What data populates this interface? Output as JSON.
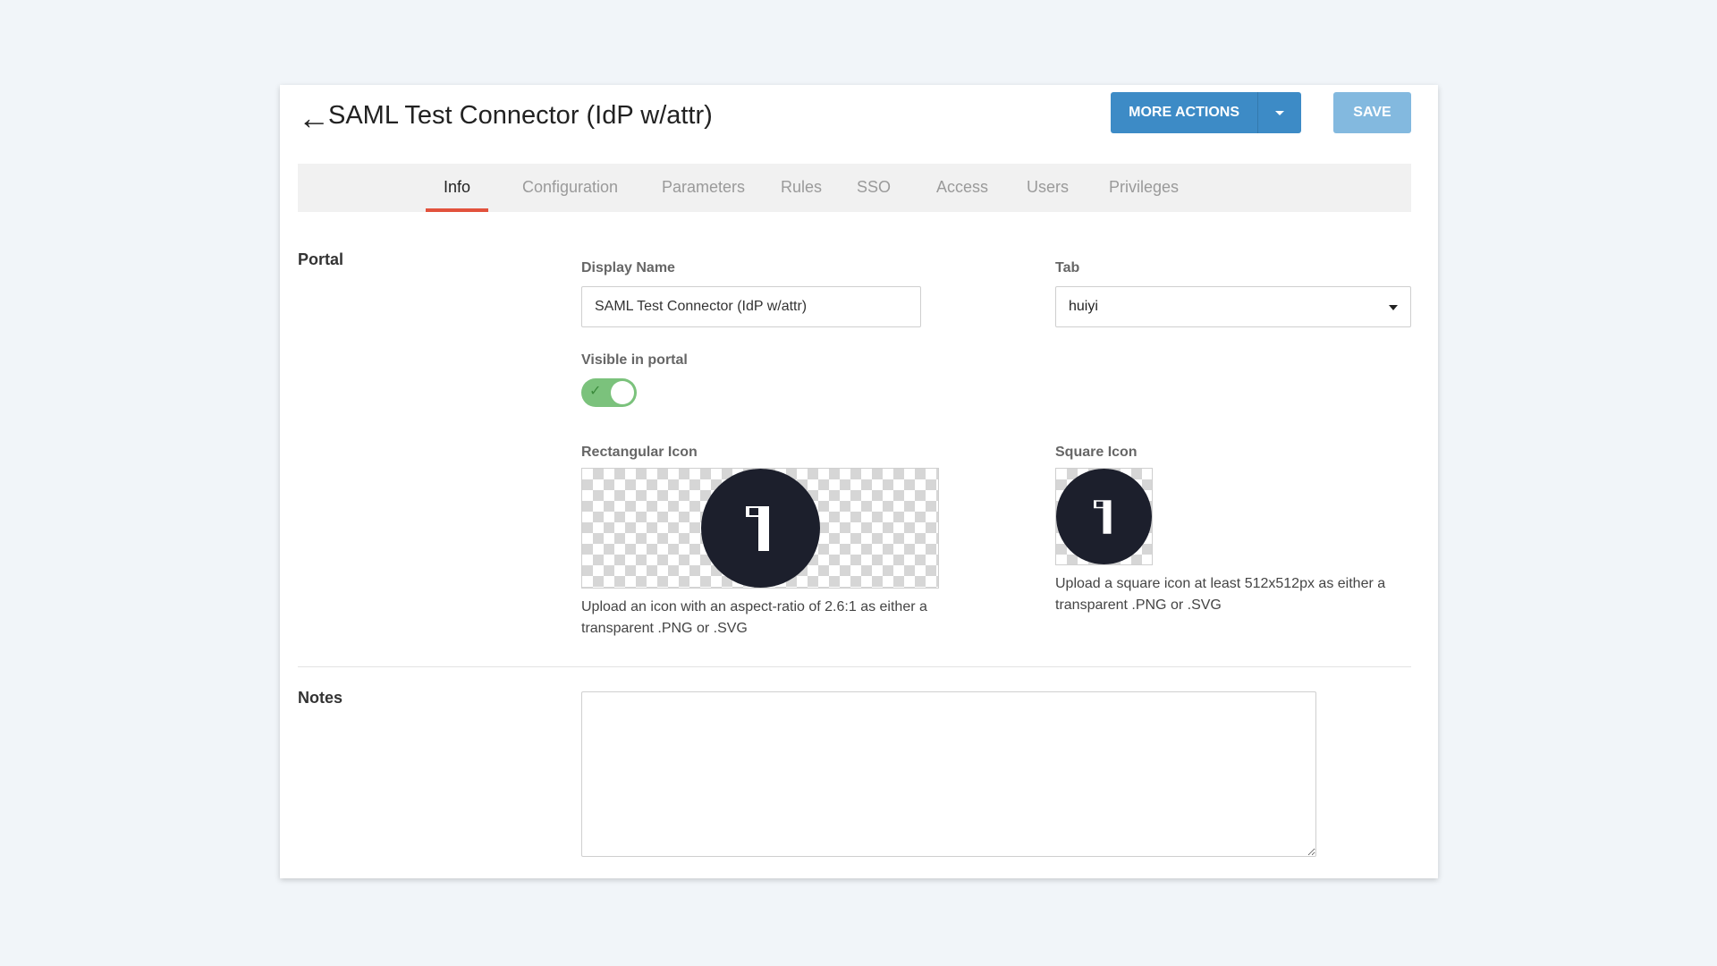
{
  "header": {
    "title": "SAML Test Connector (IdP w/attr)",
    "more_actions_label": "MORE ACTIONS",
    "save_label": "SAVE"
  },
  "tabs": [
    {
      "label": "Info",
      "active": true
    },
    {
      "label": "Configuration",
      "active": false
    },
    {
      "label": "Parameters",
      "active": false
    },
    {
      "label": "Rules",
      "active": false
    },
    {
      "label": "SSO",
      "active": false
    },
    {
      "label": "Access",
      "active": false
    },
    {
      "label": "Users",
      "active": false
    },
    {
      "label": "Privileges",
      "active": false
    }
  ],
  "portal": {
    "section_label": "Portal",
    "display_name_label": "Display Name",
    "display_name_value": "SAML Test Connector (IdP w/attr)",
    "tab_label": "Tab",
    "tab_value": "huiyi",
    "visible_label": "Visible in portal",
    "visible_on": true,
    "rect_icon_label": "Rectangular Icon",
    "rect_icon_help": "Upload an icon with an aspect-ratio of 2.6:1 as either a transparent .PNG or .SVG",
    "square_icon_label": "Square Icon",
    "square_icon_help": "Upload a square icon at least 512x512px as either a transparent .PNG or .SVG"
  },
  "notes": {
    "section_label": "Notes",
    "value": ""
  },
  "colors": {
    "primary": "#3d8bc6",
    "save_disabled": "#83b9df",
    "active_tab_underline": "#e2523d",
    "toggle_on": "#7bc27c",
    "logo_dark": "#1c1f2c"
  },
  "icons": {
    "back": "left-arrow",
    "dropdown": "caret-down",
    "toggle_check": "checkmark",
    "logo": "onelogin-1-mark"
  }
}
